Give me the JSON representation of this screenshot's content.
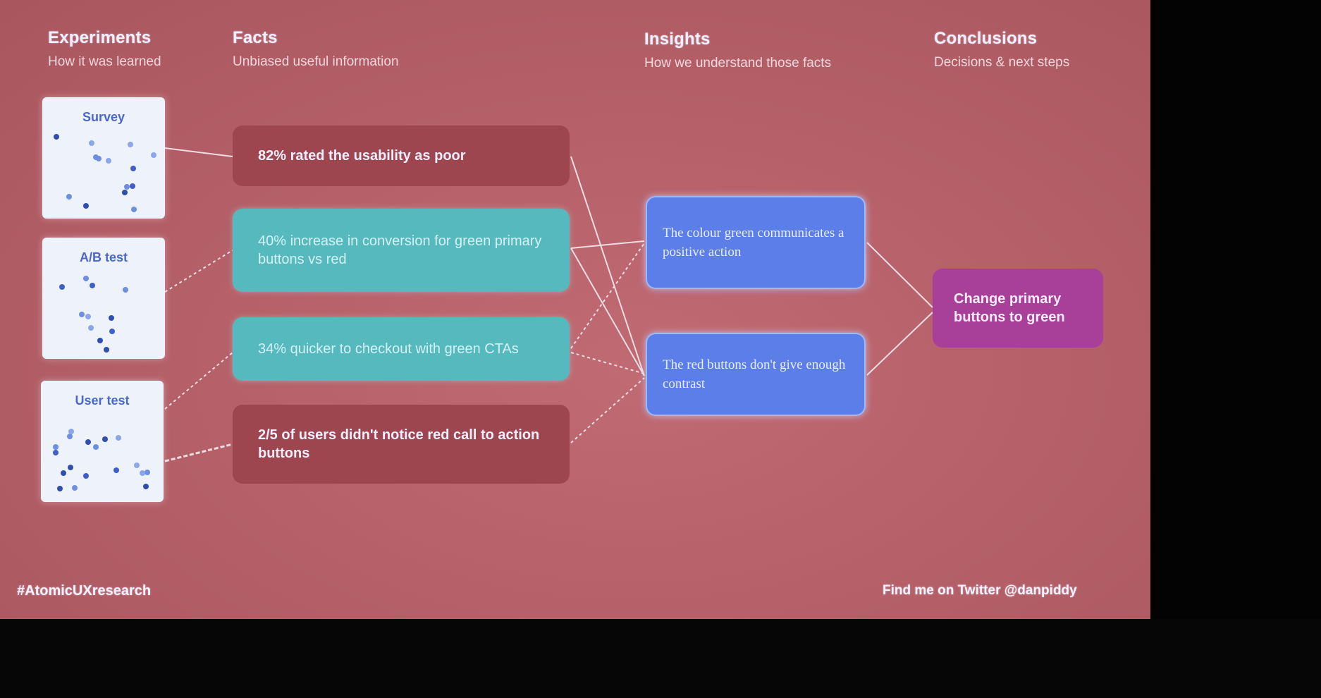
{
  "columns": {
    "experiments": {
      "title": "Experiments",
      "subtitle": "How it was learned"
    },
    "facts": {
      "title": "Facts",
      "subtitle": "Unbiased useful information"
    },
    "insights": {
      "title": "Insights",
      "subtitle": "How we understand those facts"
    },
    "conclusions": {
      "title": "Conclusions",
      "subtitle": "Decisions & next steps"
    }
  },
  "experiments": [
    {
      "label": "Survey"
    },
    {
      "label": "A/B test"
    },
    {
      "label": "User test"
    }
  ],
  "facts": [
    {
      "text": "82% rated the usability as poor",
      "color": "#9e4650"
    },
    {
      "text": "40% increase in conversion for green primary buttons vs red",
      "color": "#55b9bd"
    },
    {
      "text": "34% quicker to checkout with green CTAs",
      "color": "#55b9bd"
    },
    {
      "text": "2/5 of users didn't notice red call to action buttons",
      "color": "#9e4650"
    }
  ],
  "insights": [
    {
      "text": "The colour green communicates a positive action"
    },
    {
      "text": "The red buttons don't give enough contrast"
    }
  ],
  "conclusion": {
    "text": "Change primary buttons to green"
  },
  "footer": {
    "hashtag": "#AtomicUXresearch",
    "twitter": "Find me on Twitter @danpiddy"
  },
  "colors": {
    "slide_background": "#b45f68",
    "fact_red": "#9e4650",
    "fact_teal": "#55b9bd",
    "insight_blue": "#5b7ee8",
    "conclusion_purple": "#a83f99"
  }
}
